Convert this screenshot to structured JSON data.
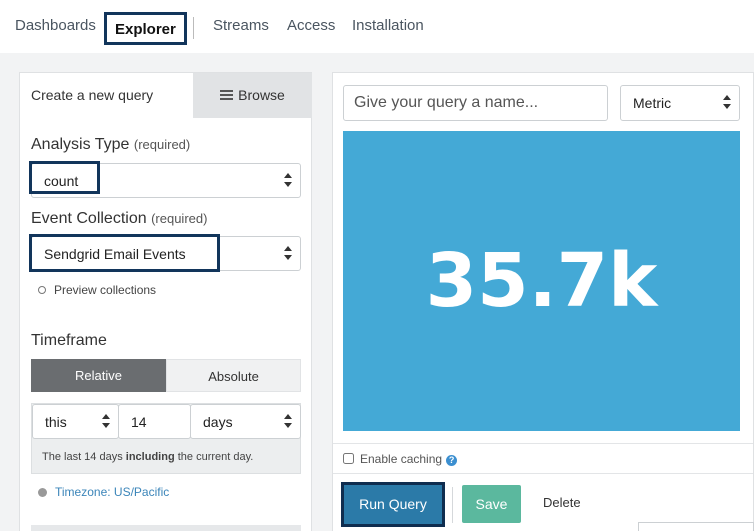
{
  "nav": {
    "items": [
      {
        "label": "Dashboards"
      },
      {
        "label": "Explorer",
        "active": true
      },
      {
        "label": "Streams"
      },
      {
        "label": "Access"
      },
      {
        "label": "Installation"
      }
    ]
  },
  "query": {
    "tabs": {
      "create": "Create a new query",
      "browse": "Browse"
    },
    "analysis_type": {
      "label": "Analysis Type",
      "required": "(required)",
      "value": "count"
    },
    "event_collection": {
      "label": "Event Collection",
      "required": "(required)",
      "value": "Sendgrid Email Events"
    },
    "preview_link": "Preview collections",
    "timeframe": {
      "label": "Timeframe",
      "relative_tab": "Relative",
      "absolute_tab": "Absolute",
      "relativity": "this",
      "amount": "14",
      "unit": "days",
      "note_prefix": "The last 14 days",
      "note_bold": "including",
      "note_suffix": "the current day."
    },
    "timezone": "Timezone: US/Pacific"
  },
  "result": {
    "name_placeholder": "Give your query a name...",
    "viz_type": "Metric",
    "metric_value": "35.7k",
    "metric_color": "#44a9d6",
    "caching_label": "Enable caching",
    "help_icon": "?",
    "run_label": "Run Query",
    "save_label": "Save",
    "delete_label": "Delete"
  }
}
